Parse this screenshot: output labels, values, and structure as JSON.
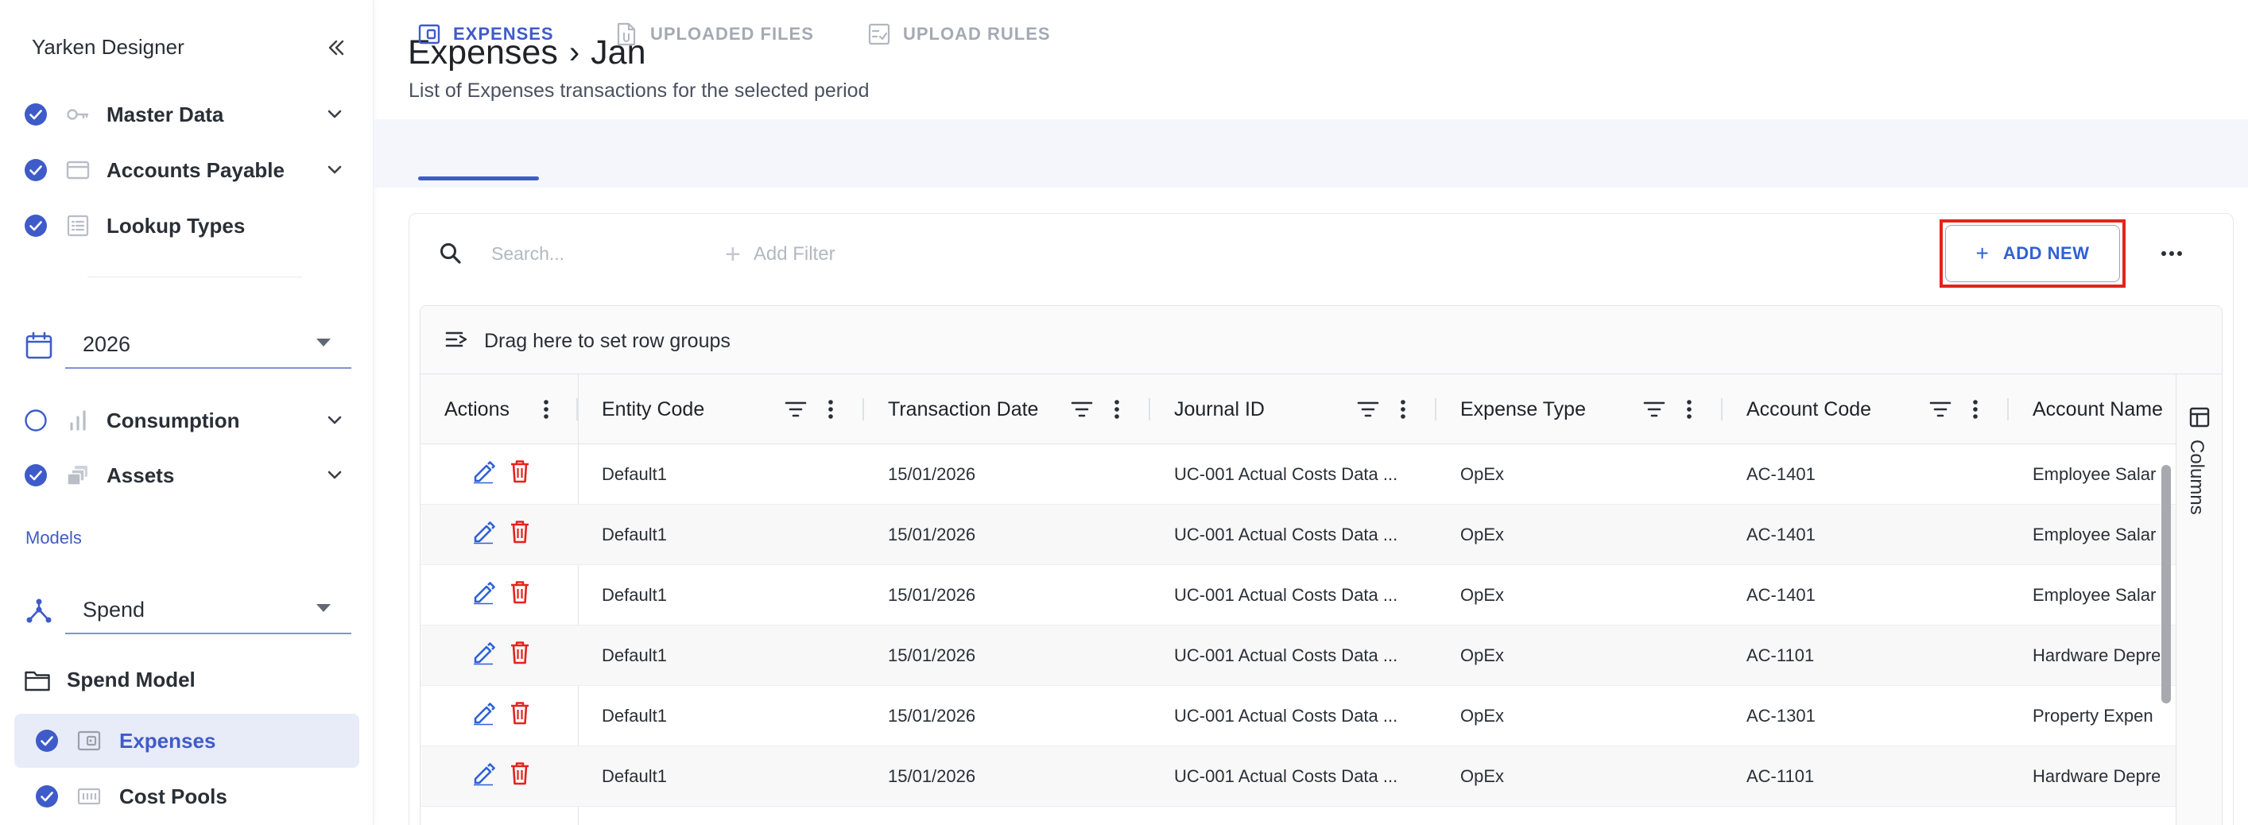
{
  "sidebar": {
    "app_title": "Yarken Designer",
    "items": [
      {
        "label": "Master Data",
        "status": "checked",
        "icon": "key-icon"
      },
      {
        "label": "Accounts Payable",
        "status": "checked",
        "icon": "credit-card-icon"
      },
      {
        "label": "Lookup Types",
        "status": "checked",
        "icon": "list-icon"
      }
    ],
    "year_select": {
      "value": "2026",
      "icon": "calendar-icon"
    },
    "items2": [
      {
        "label": "Consumption",
        "status": "unchecked",
        "icon": "bar-chart-icon"
      },
      {
        "label": "Assets",
        "status": "checked",
        "icon": "layers-icon"
      }
    ],
    "models_label": "Models",
    "model_select": {
      "value": "Spend",
      "icon": "hierarchy-icon"
    },
    "folder": {
      "label": "Spend Model",
      "icon": "folder-icon"
    },
    "sub_items": [
      {
        "label": "Expenses",
        "active": true,
        "icon": "wallet-icon"
      },
      {
        "label": "Cost Pools",
        "active": false,
        "icon": "grid-pool-icon"
      }
    ]
  },
  "header": {
    "title": "Expenses",
    "title_sub": "Jan",
    "separator": "›",
    "subtitle": "List of Expenses transactions for the selected period"
  },
  "tabs": [
    {
      "label": "EXPENSES",
      "active": true
    },
    {
      "label": "UPLOADED FILES",
      "active": false
    },
    {
      "label": "UPLOAD RULES",
      "active": false
    }
  ],
  "toolbar": {
    "search_placeholder": "Search...",
    "add_filter_label": "Add Filter",
    "add_new_label": "ADD NEW",
    "plus": "+"
  },
  "grid": {
    "group_hint": "Drag here to set row groups",
    "columns_label": "Columns",
    "headers": [
      "Actions",
      "Entity Code",
      "Transaction Date",
      "Journal ID",
      "Expense Type",
      "Account Code",
      "Account Name"
    ],
    "rows": [
      [
        "Default1",
        "15/01/2026",
        "UC-001 Actual Costs Data ...",
        "OpEx",
        "AC-1401",
        "Employee Salar"
      ],
      [
        "Default1",
        "15/01/2026",
        "UC-001 Actual Costs Data ...",
        "OpEx",
        "AC-1401",
        "Employee Salar"
      ],
      [
        "Default1",
        "15/01/2026",
        "UC-001 Actual Costs Data ...",
        "OpEx",
        "AC-1401",
        "Employee Salar"
      ],
      [
        "Default1",
        "15/01/2026",
        "UC-001 Actual Costs Data ...",
        "OpEx",
        "AC-1101",
        "Hardware Depre"
      ],
      [
        "Default1",
        "15/01/2026",
        "UC-001 Actual Costs Data ...",
        "OpEx",
        "AC-1301",
        "Property Expen"
      ],
      [
        "Default1",
        "15/01/2026",
        "UC-001 Actual Costs Data ...",
        "OpEx",
        "AC-1101",
        "Hardware Depre"
      ]
    ]
  },
  "colors": {
    "accent": "#3f5bc9",
    "primary_button": "#2f61d6",
    "delete": "#e3241b",
    "highlight": "#e3241b"
  }
}
